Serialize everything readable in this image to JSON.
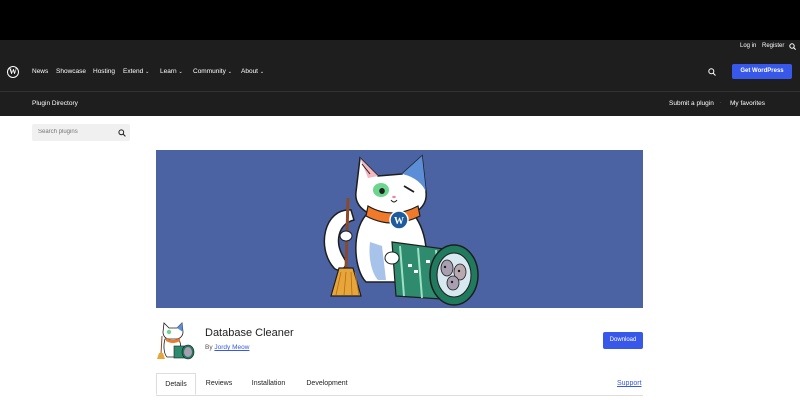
{
  "util": {
    "login": "Log in",
    "register": "Register"
  },
  "nav": {
    "items": [
      "News",
      "Showcase",
      "Hosting",
      "Extend",
      "Learn",
      "Community",
      "About"
    ],
    "cta": "Get WordPress"
  },
  "subnav": {
    "title": "Plugin Directory",
    "submit": "Submit a plugin",
    "favorites": "My favorites"
  },
  "search": {
    "placeholder": "Search plugins"
  },
  "plugin": {
    "name": "Database Cleaner",
    "by": "By",
    "author": "Jordy Meow",
    "download": "Download"
  },
  "tabs": [
    "Details",
    "Reviews",
    "Installation",
    "Development"
  ],
  "support": "Support",
  "colors": {
    "accent": "#3858e9",
    "banner": "#4c63a3",
    "dark": "#1e1e1e"
  }
}
